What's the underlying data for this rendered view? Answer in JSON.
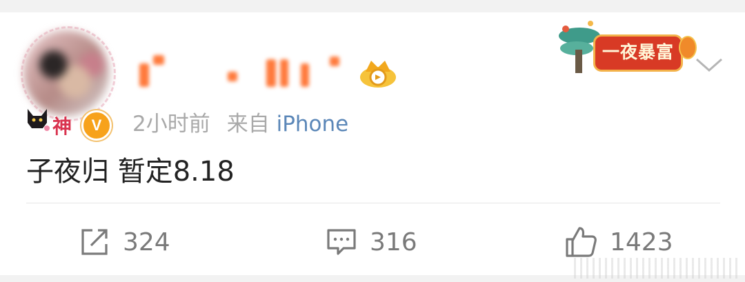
{
  "post": {
    "time": "2小时前",
    "source_prefix": "来自",
    "source_device": "iPhone",
    "content": "子夜归 暂定8.18",
    "avatar_badge_text": "神",
    "verified_badge": "V",
    "promo_badge": "一夜暴富"
  },
  "actions": {
    "repost_count": "324",
    "comment_count": "316",
    "like_count": "1423"
  },
  "icons": {
    "repost": "share-icon",
    "comment": "comment-icon",
    "like": "thumbs-up-icon",
    "more": "chevron-down-icon",
    "crown": "crown-icon"
  },
  "colors": {
    "accent_link": "#5b87b8",
    "verified": "#f7a21b",
    "promo_red": "#d83a25",
    "text_primary": "#222222",
    "text_secondary": "#a9a9a9"
  }
}
